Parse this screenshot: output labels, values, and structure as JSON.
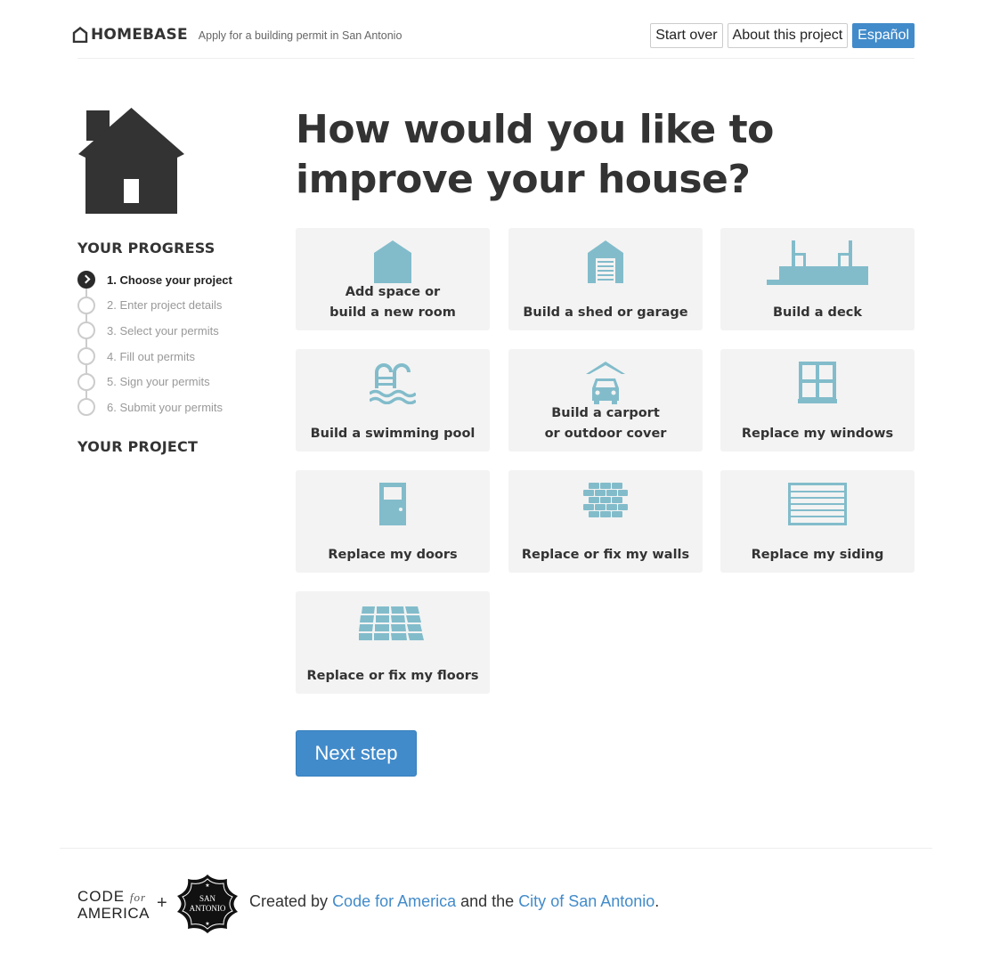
{
  "header": {
    "brand": "HOMEBASE",
    "tagline": "Apply for a building permit in San Antonio",
    "buttons": [
      "Start over",
      "About this project",
      "Español"
    ]
  },
  "sidebar": {
    "progress_heading": "YOUR PROGRESS",
    "steps": [
      {
        "label": "1. Choose your project",
        "active": true
      },
      {
        "label": "2. Enter project details",
        "active": false
      },
      {
        "label": "3. Select your permits",
        "active": false
      },
      {
        "label": "4. Fill out permits",
        "active": false
      },
      {
        "label": "5. Sign your permits",
        "active": false
      },
      {
        "label": "6. Submit your permits",
        "active": false
      }
    ],
    "project_heading": "YOUR PROJECT"
  },
  "main": {
    "title": "How would you like to improve your house?",
    "tiles": [
      {
        "label": "Add space or\nbuild a new room",
        "icon": "room-addition-icon"
      },
      {
        "label": "Build a shed or garage",
        "icon": "garage-icon"
      },
      {
        "label": "Build a deck",
        "icon": "deck-icon"
      },
      {
        "label": "Build a swimming pool",
        "icon": "pool-icon"
      },
      {
        "label": "Build a carport\nor outdoor cover",
        "icon": "carport-icon"
      },
      {
        "label": "Replace my windows",
        "icon": "window-icon"
      },
      {
        "label": "Replace my doors",
        "icon": "door-icon"
      },
      {
        "label": "Replace or fix my walls",
        "icon": "brick-wall-icon"
      },
      {
        "label": "Replace my siding",
        "icon": "siding-icon"
      },
      {
        "label": "Replace or fix my floors",
        "icon": "floor-tiles-icon"
      }
    ],
    "next_button": "Next step"
  },
  "footer": {
    "cfa_line1": "CODE",
    "cfa_for": "for",
    "cfa_line2": "AMERICA",
    "plus": "+",
    "seal_text": [
      "SAN",
      "ANTONIO"
    ],
    "text_prefix": "Created by ",
    "link1": "Code for America",
    "text_middle": " and the ",
    "link2": "City of San Antonio",
    "text_suffix": "."
  },
  "colors": {
    "accent": "#428bca",
    "icon": "#82bccb",
    "tile_bg": "#f3f3f3",
    "text": "#333333"
  }
}
